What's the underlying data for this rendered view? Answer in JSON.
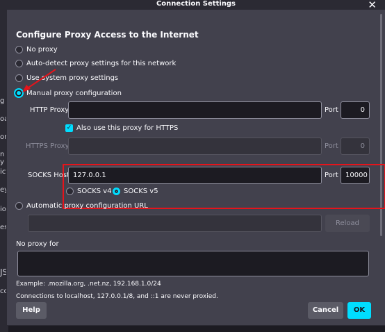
{
  "background_fragments": [
    "g",
    "oa",
    "or",
    "n y",
    "ict",
    "ey",
    "io",
    "es",
    "JS",
    "cc"
  ],
  "dialog": {
    "title": "Connection Settings",
    "close_icon": "close-icon",
    "heading": "Configure Proxy Access to the Internet",
    "proxy_options": [
      {
        "label": "No proxy",
        "selected": false
      },
      {
        "label": "Auto-detect proxy settings for this network",
        "selected": false
      },
      {
        "label": "Use system proxy settings",
        "selected": false
      },
      {
        "label": "Manual proxy configuration",
        "selected": true
      }
    ],
    "http": {
      "label": "HTTP Proxy",
      "value": "",
      "port_label": "Port",
      "port": "0"
    },
    "https_checkbox": {
      "label": "Also use this proxy for HTTPS",
      "checked": true
    },
    "https": {
      "label": "HTTPS Proxy",
      "value": "",
      "port_label": "Port",
      "port": "0"
    },
    "socks": {
      "label": "SOCKS Host",
      "value": "127.0.0.1",
      "port_label": "Port",
      "port": "10000"
    },
    "socks_version": [
      {
        "label": "SOCKS v4",
        "selected": false
      },
      {
        "label": "SOCKS v5",
        "selected": true
      }
    ],
    "auto_config": {
      "label": "Automatic proxy configuration URL",
      "value": "",
      "reload_label": "Reload"
    },
    "no_proxy": {
      "label": "No proxy for",
      "value": ""
    },
    "example_text": "Example: .mozilla.org, .net.nz, 192.168.1.0/24",
    "localhost_note": "Connections to localhost, 127.0.0.1/8, and ::1 are never proxied.",
    "buttons": {
      "help": "Help",
      "cancel": "Cancel",
      "ok": "OK"
    },
    "colors": {
      "accent": "#00ddff",
      "annotation": "#e5141b",
      "dialog_bg": "#42414d"
    }
  }
}
